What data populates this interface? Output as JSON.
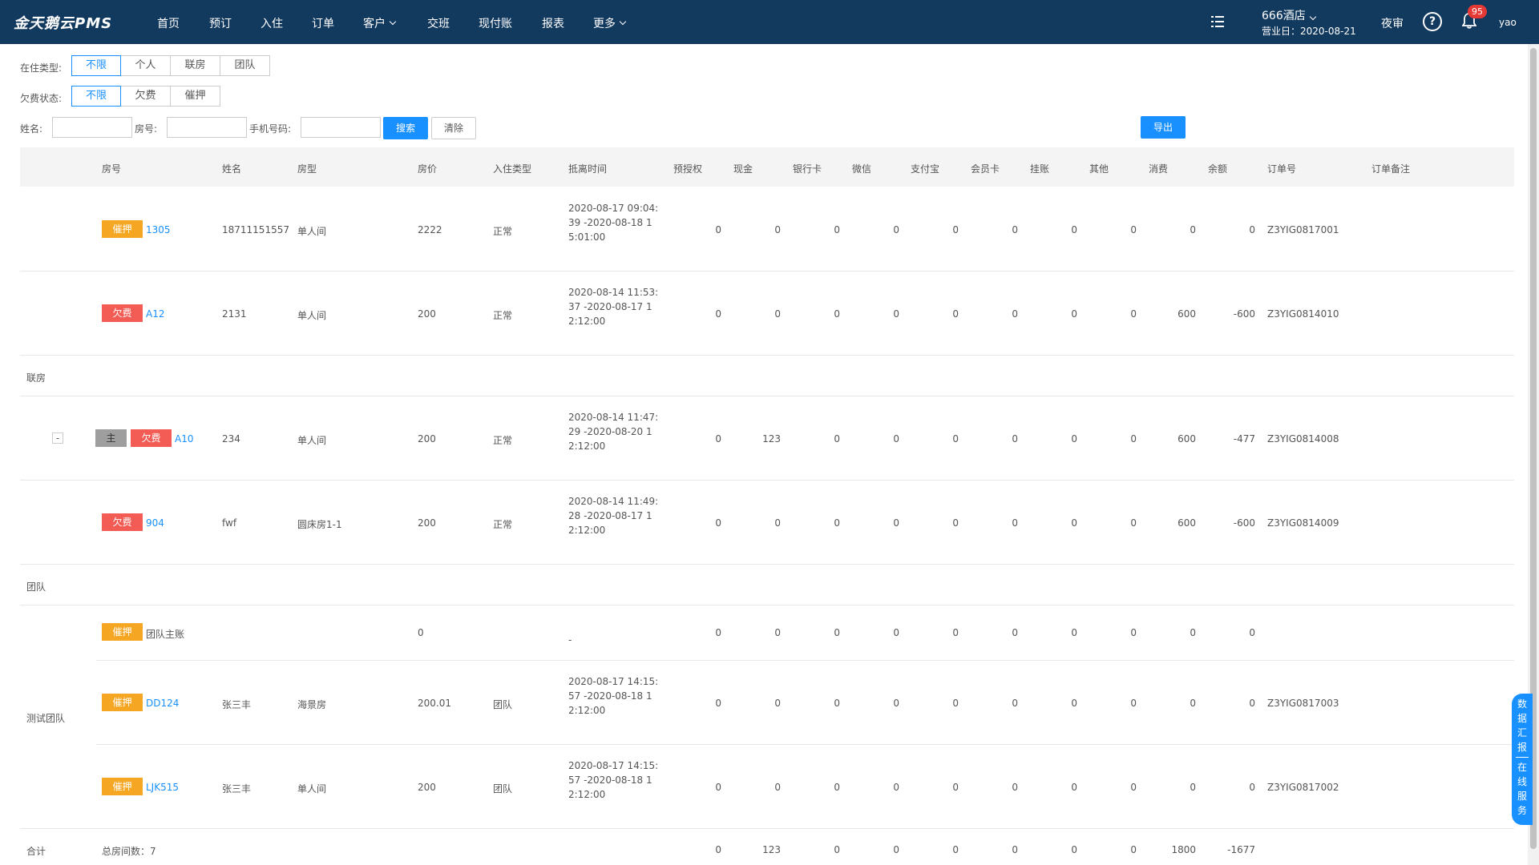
{
  "app": {
    "brand": "金天鹅云PMS",
    "nav": [
      {
        "label": "首页",
        "dropdown": false
      },
      {
        "label": "预订",
        "dropdown": false
      },
      {
        "label": "入住",
        "dropdown": false
      },
      {
        "label": "订单",
        "dropdown": false
      },
      {
        "label": "客户",
        "dropdown": true
      },
      {
        "label": "交班",
        "dropdown": false
      },
      {
        "label": "现付账",
        "dropdown": false
      },
      {
        "label": "报表",
        "dropdown": false
      },
      {
        "label": "更多",
        "dropdown": true
      }
    ],
    "hotel_name": "666酒店",
    "business_date": "营业日：2020-08-21",
    "night_audit": "夜审",
    "help": "?",
    "notification_count": "95",
    "user": "yao"
  },
  "filters": {
    "stay_type_label": "在住类型:",
    "stay_type_options": [
      "不限",
      "个人",
      "联房",
      "团队"
    ],
    "arrears_label": "欠费状态:",
    "arrears_options": [
      "不限",
      "欠费",
      "催押"
    ],
    "name_label": "姓名:",
    "room_label": "房号:",
    "phone_label": "手机号码:",
    "search_button": "搜索",
    "clear_button": "清除",
    "export_button": "导出"
  },
  "table": {
    "columns": [
      "房号",
      "姓名",
      "房型",
      "房价",
      "入住类型",
      "抵离时间",
      "预授权",
      "现金",
      "银行卡",
      "微信",
      "支付宝",
      "会员卡",
      "挂账",
      "其他",
      "消费",
      "余额",
      "订单号",
      "订单备注"
    ],
    "individual_rows": [
      {
        "tag": "催押",
        "tag_color": "orange",
        "room": "1305",
        "name": "18711151557",
        "room_type": "单人间",
        "price": "2222",
        "type": "正常",
        "time": "2020-08-17 09:04:39 -2020-08-18 15:01:00",
        "pre_auth": "0",
        "cash": "0",
        "bank": "0",
        "wechat": "0",
        "alipay": "0",
        "member": "0",
        "credit": "0",
        "other": "0",
        "consume": "0",
        "balance": "0",
        "order": "Z3YIG0817001"
      },
      {
        "tag": "欠费",
        "tag_color": "red",
        "room": "A12",
        "name": "2131",
        "room_type": "单人间",
        "price": "200",
        "type": "正常",
        "time": "2020-08-14 11:53:37 -2020-08-17 12:12:00",
        "pre_auth": "0",
        "cash": "0",
        "bank": "0",
        "wechat": "0",
        "alipay": "0",
        "member": "0",
        "credit": "0",
        "other": "0",
        "consume": "600",
        "balance": "-600",
        "order": "Z3YIG0814010"
      }
    ],
    "linked_group_label": "联房",
    "linked_rows": [
      {
        "master": "主",
        "tag": "欠费",
        "tag_color": "red",
        "room": "A10",
        "name": "234",
        "room_type": "单人间",
        "price": "200",
        "type": "正常",
        "time": "2020-08-14 11:47:29 -2020-08-20 12:12:00",
        "pre_auth": "0",
        "cash": "123",
        "bank": "0",
        "wechat": "0",
        "alipay": "0",
        "member": "0",
        "credit": "0",
        "other": "0",
        "consume": "600",
        "balance": "-477",
        "order": "Z3YIG0814008"
      },
      {
        "tag": "欠费",
        "tag_color": "red",
        "room": "904",
        "name": "fwf",
        "room_type": "圆床房1-1",
        "price": "200",
        "type": "正常",
        "time": "2020-08-14 11:49:28 -2020-08-17 12:12:00",
        "pre_auth": "0",
        "cash": "0",
        "bank": "0",
        "wechat": "0",
        "alipay": "0",
        "member": "0",
        "credit": "0",
        "other": "0",
        "consume": "600",
        "balance": "-600",
        "order": "Z3YIG0814009"
      }
    ],
    "expander": "-",
    "team_group_label": "团队",
    "team_name": "测试团队",
    "team_rows": [
      {
        "tag": "催押",
        "tag_color": "orange",
        "room": "团队主账",
        "name": "",
        "room_type": "",
        "price": "0",
        "type": "",
        "time": "-",
        "pre_auth": "0",
        "cash": "0",
        "bank": "0",
        "wechat": "0",
        "alipay": "0",
        "member": "0",
        "credit": "0",
        "other": "0",
        "consume": "0",
        "balance": "0",
        "order": ""
      },
      {
        "tag": "催押",
        "tag_color": "orange",
        "room": "DD124",
        "name": "张三丰",
        "room_type": "海景房",
        "price": "200.01",
        "type": "团队",
        "time": "2020-08-17 14:15:57 -2020-08-18 12:12:00",
        "pre_auth": "0",
        "cash": "0",
        "bank": "0",
        "wechat": "0",
        "alipay": "0",
        "member": "0",
        "credit": "0",
        "other": "0",
        "consume": "0",
        "balance": "0",
        "order": "Z3YIG0817003"
      },
      {
        "tag": "催押",
        "tag_color": "orange",
        "room": "LJK515",
        "name": "张三丰",
        "room_type": "单人间",
        "price": "200",
        "type": "团队",
        "time": "2020-08-17 14:15:57 -2020-08-18 12:12:00",
        "pre_auth": "0",
        "cash": "0",
        "bank": "0",
        "wechat": "0",
        "alipay": "0",
        "member": "0",
        "credit": "0",
        "other": "0",
        "consume": "0",
        "balance": "0",
        "order": "Z3YIG0817002"
      }
    ],
    "totals": {
      "label": "合计",
      "rooms": "总房间数：7",
      "pre_auth": "0",
      "cash": "123",
      "bank": "0",
      "wechat": "0",
      "alipay": "0",
      "member": "0",
      "credit": "0",
      "other": "0",
      "consume": "1800",
      "balance": "-1677"
    }
  },
  "float_panel": {
    "top": "数据汇报",
    "bottom": "在线服务"
  },
  "colors": {
    "nav_bg": "#12395e",
    "primary": "#1890ff",
    "orange_tag": "#f5a623",
    "red_tag": "#f25c54"
  }
}
